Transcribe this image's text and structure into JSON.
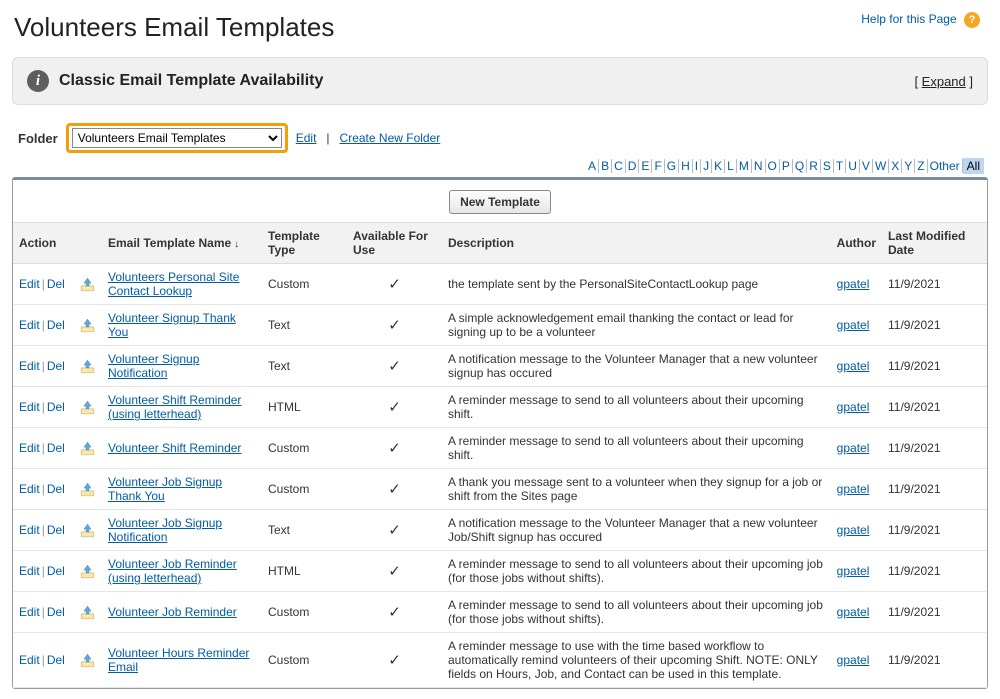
{
  "page_title": "Volunteers Email Templates",
  "help": {
    "text": "Help for this Page"
  },
  "banner": {
    "title": "Classic Email Template Availability",
    "expand": "Expand"
  },
  "folder": {
    "label": "Folder",
    "selected": "Volunteers Email Templates",
    "edit": "Edit",
    "create": "Create New Folder"
  },
  "alpha": {
    "letters": [
      "A",
      "B",
      "C",
      "D",
      "E",
      "F",
      "G",
      "H",
      "I",
      "J",
      "K",
      "L",
      "M",
      "N",
      "O",
      "P",
      "Q",
      "R",
      "S",
      "T",
      "U",
      "V",
      "W",
      "X",
      "Y",
      "Z"
    ],
    "other": "Other",
    "all": "All"
  },
  "new_button": "New Template",
  "headers": {
    "action": "Action",
    "name": "Email Template Name",
    "type": "Template Type",
    "avail": "Available For Use",
    "desc": "Description",
    "author": "Author",
    "date": "Last Modified Date"
  },
  "row_actions": {
    "edit": "Edit",
    "del": "Del"
  },
  "author": "gpatel",
  "date": "11/9/2021",
  "rows": [
    {
      "name": "Volunteers Personal Site Contact Lookup",
      "type": "Custom",
      "desc": "the template sent by the PersonalSiteContactLookup page"
    },
    {
      "name": "Volunteer Signup Thank You",
      "type": "Text",
      "desc": "A simple acknowledgement email thanking the contact or lead for signing up to be a volunteer"
    },
    {
      "name": "Volunteer Signup Notification",
      "type": "Text",
      "desc": "A notification message to the Volunteer Manager that a new volunteer signup has occured"
    },
    {
      "name": "Volunteer Shift Reminder (using letterhead)",
      "type": "HTML",
      "desc": "A reminder message to send to all volunteers about their upcoming shift."
    },
    {
      "name": "Volunteer Shift Reminder",
      "type": "Custom",
      "desc": "A reminder message to send to all volunteers about their upcoming shift."
    },
    {
      "name": "Volunteer Job Signup Thank You",
      "type": "Custom",
      "desc": "A thank you message sent to a volunteer when they signup for a job or shift from the Sites page"
    },
    {
      "name": "Volunteer Job Signup Notification",
      "type": "Text",
      "desc": "A notification message to the Volunteer Manager that a new volunteer Job/Shift signup has occured"
    },
    {
      "name": "Volunteer Job Reminder (using letterhead)",
      "type": "HTML",
      "desc": "A reminder message to send to all volunteers about their upcoming job (for those jobs without shifts)."
    },
    {
      "name": "Volunteer Job Reminder",
      "type": "Custom",
      "desc": "A reminder message to send to all volunteers about their upcoming job (for those jobs without shifts)."
    },
    {
      "name": "Volunteer Hours Reminder Email",
      "type": "Custom",
      "desc": "A reminder message to use with the time based workflow to automatically remind volunteers of their upcoming Shift. NOTE: ONLY fields on Hours, Job, and Contact can be used in this template."
    }
  ]
}
